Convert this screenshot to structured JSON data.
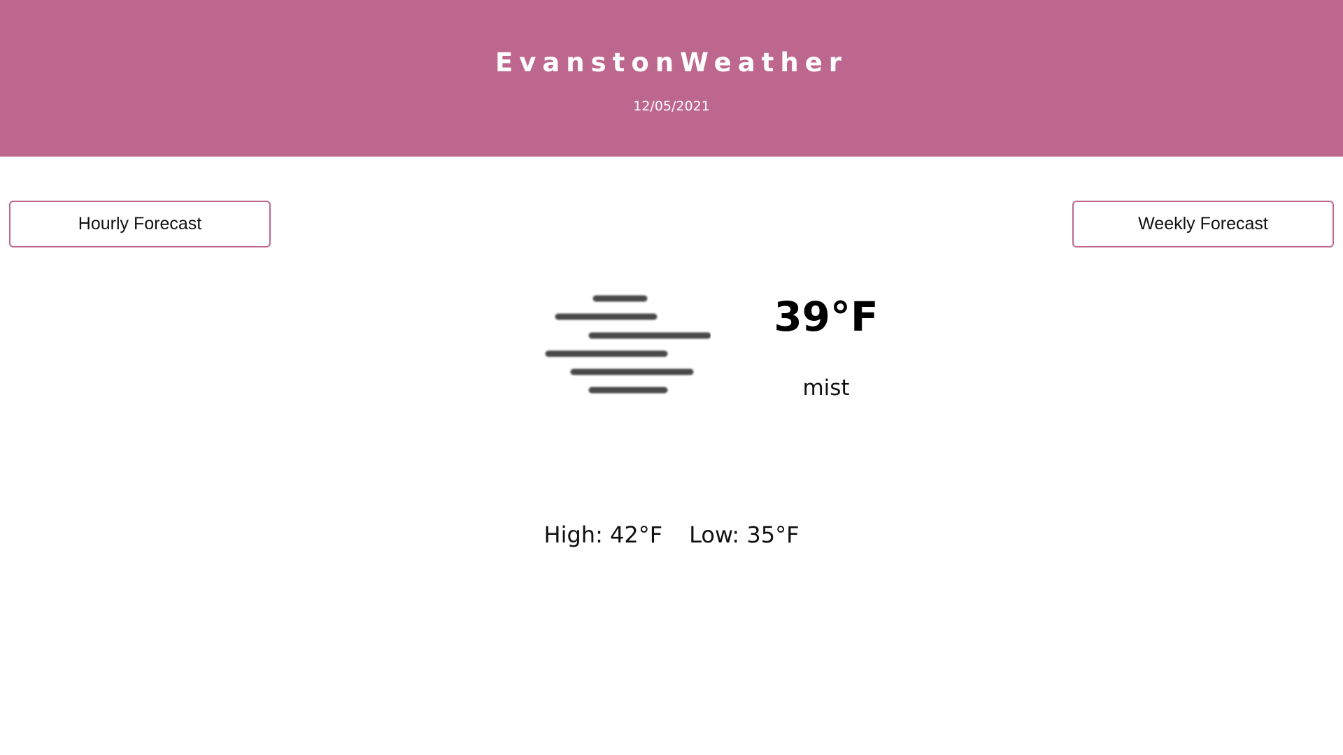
{
  "header": {
    "title": "EvanstonWeather",
    "date": "12/05/2021",
    "background_color": "#be678e"
  },
  "nav": {
    "hourly_label": "Hourly Forecast",
    "weekly_label": "Weekly Forecast",
    "border_color": "#be678e"
  },
  "current": {
    "icon": "mist-icon",
    "temperature": "39°F",
    "condition": "mist",
    "high": "High: 42°F",
    "low": "Low: 35°F"
  }
}
